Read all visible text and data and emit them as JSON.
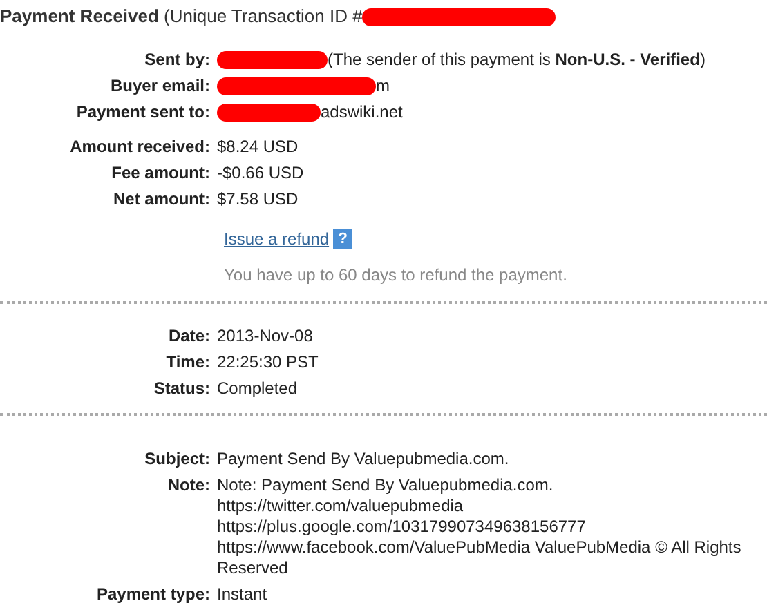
{
  "title": {
    "text": "**Payment Received** (Unique Transaction ID #",
    "redacted": true
  },
  "sections": [
    {
      "rows": [
        {
          "label": "Sent by:",
          "redacted": true,
          "value": "(The sender of this payment is **Non-U.S. - Verified**)"
        },
        {
          "label": "Buyer email:",
          "redacted": true,
          "value": "m"
        },
        {
          "label": "Payment sent to:",
          "redacted": true,
          "value": "adswiki.net"
        }
      ]
    },
    {
      "rows": [
        {
          "label": "Amount received:",
          "redacted": false,
          "value": "$8.24 USD"
        },
        {
          "label": "Fee amount:",
          "redacted": false,
          "value": "-$0.66 USD"
        },
        {
          "label": "Net amount:",
          "redacted": false,
          "value": "$7.58 USD"
        }
      ],
      "refund": {
        "link": "Issue a refund",
        "help": "?",
        "note": "You have up to 60 days to refund the payment."
      },
      "divider": true
    },
    {
      "rows": [
        {
          "label": "Date:",
          "redacted": false,
          "value": "2013-Nov-08"
        },
        {
          "label": "Time:",
          "redacted": false,
          "value": "22:25:30 PST"
        },
        {
          "label": "Status:",
          "redacted": false,
          "value": "Completed"
        }
      ],
      "divider": true
    },
    {
      "rows": [
        {
          "label": "Subject:",
          "redacted": false,
          "value": "Payment Send By Valuepubmedia.com."
        },
        {
          "label": "Note:",
          "redacted": false,
          "lines": [
            "Note: Payment Send By Valuepubmedia.com.",
            "https://twitter.com/valuepubmedia",
            "https://plus.google.com/103179907349638156777",
            "https://www.facebook.com/ValuePubMedia ValuePubMedia © All Rights Reserved"
          ]
        },
        {
          "label": "Payment type:",
          "redacted": false,
          "value": "Instant"
        }
      ]
    }
  ]
}
